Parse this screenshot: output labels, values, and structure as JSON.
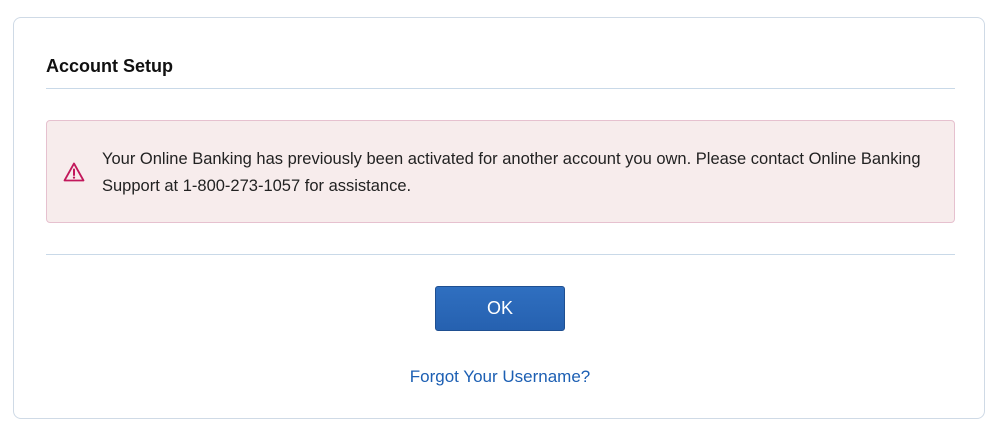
{
  "dialog": {
    "title": "Account Setup"
  },
  "alert": {
    "icon": "warning-triangle-icon",
    "message": "Your Online Banking has previously been activated for another account you own. Please contact Online Banking Support at 1-800-273-1057 for assistance.",
    "accent_color": "#c2185b",
    "background_color": "#f7ecec"
  },
  "actions": {
    "ok_label": "OK",
    "forgot_username_label": "Forgot Your Username?",
    "button_color": "#2a66b5",
    "link_color": "#1c5fb3"
  }
}
